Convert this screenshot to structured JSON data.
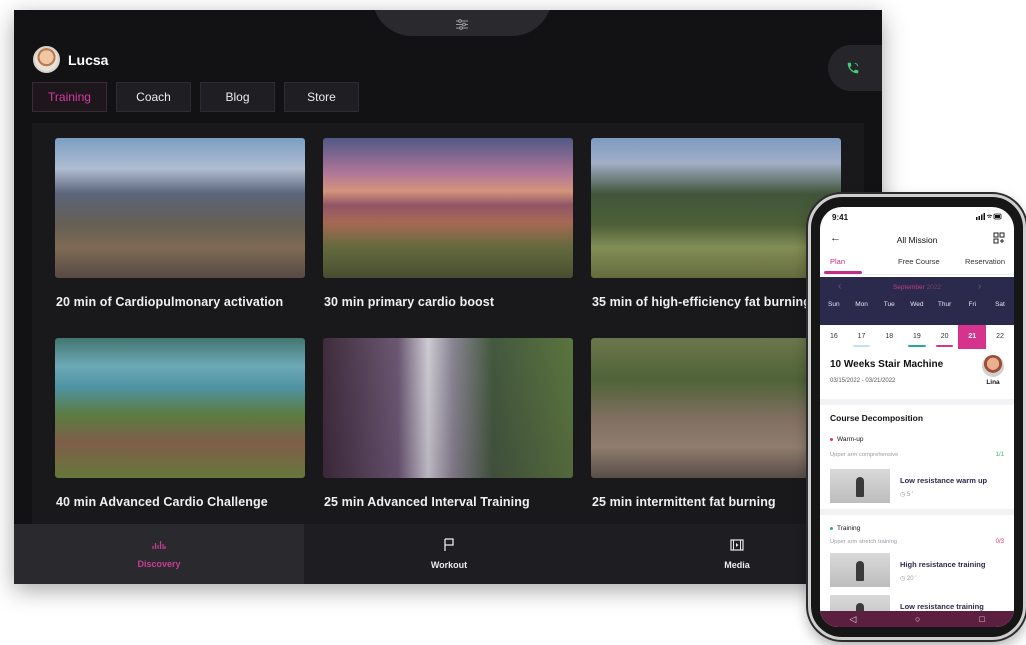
{
  "tablet": {
    "user": {
      "name": "Lucsa"
    },
    "tabs": [
      {
        "label": "Training",
        "active": true
      },
      {
        "label": "Coach"
      },
      {
        "label": "Blog"
      },
      {
        "label": "Store"
      }
    ],
    "cards": [
      {
        "title": "20 min of Cardiopulmonary activation"
      },
      {
        "title": "30 min primary cardio boost"
      },
      {
        "title": "35 min of high-efficiency fat burning"
      },
      {
        "title": "40 min Advanced Cardio Challenge"
      },
      {
        "title": "25 min Advanced Interval Training"
      },
      {
        "title": "25 min intermittent fat burning"
      }
    ],
    "nav": [
      {
        "label": "Discovery",
        "icon": "activity-icon",
        "active": true
      },
      {
        "label": "Workout",
        "icon": "flag-icon"
      },
      {
        "label": "Media",
        "icon": "film-icon"
      }
    ],
    "colors": {
      "accent": "#d63aa4",
      "background": "#121214"
    }
  },
  "phone": {
    "status": {
      "time": "9:41",
      "icons": "signal wifi battery"
    },
    "header": {
      "title": "All Mission",
      "back_icon": "back-arrow-icon",
      "action_icon": "grid-icon"
    },
    "tabs": [
      {
        "label": "Plan",
        "active": true
      },
      {
        "label": "Free Course"
      },
      {
        "label": "Reservation"
      }
    ],
    "calendar": {
      "month": "September",
      "year": "2022",
      "weekdays": [
        "Sun",
        "Mon",
        "Tue",
        "Wed",
        "Thur",
        "Fri",
        "Sat"
      ],
      "dates": [
        "16",
        "17",
        "18",
        "19",
        "20",
        "21",
        "22"
      ],
      "selected": "21"
    },
    "mission": {
      "title": "10 Weeks Stair Machine",
      "dates": "03/15/2022 - 03/21/2022",
      "coach": "Lina"
    },
    "decomposition": {
      "title": "Course Decomposition",
      "groups": [
        {
          "name": "Warm-up",
          "sub": "Upper arm comprehensive",
          "count": "1/1",
          "dot_color": "#e0306a",
          "count_color": "#3cb371",
          "lessons": [
            {
              "name": "Low resistance warm up",
              "duration": "5 '"
            }
          ]
        },
        {
          "name": "Training",
          "sub": "Upper arm stretch training",
          "count": "0/3",
          "dot_color": "#2aa79b",
          "count_color": "#e0306a",
          "lessons": [
            {
              "name": "High resistance training",
              "duration": "20 '"
            },
            {
              "name": "Low resistance training"
            }
          ]
        }
      ]
    }
  }
}
